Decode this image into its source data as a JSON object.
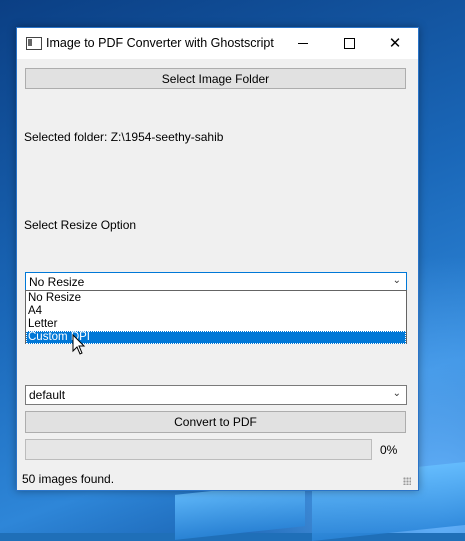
{
  "window": {
    "title": "Image to PDF Converter with Ghostscript",
    "controls": {
      "minimize": "minimize",
      "maximize": "maximize",
      "close": "✕"
    }
  },
  "select_folder_button": "Select Image Folder",
  "selected_folder_text": "Selected folder: Z:\\1954-seethy-sahib",
  "resize_label": "Select Resize Option",
  "resize_combo": {
    "value": "No Resize",
    "options": [
      "No Resize",
      "A4",
      "Letter",
      "Custom DPI"
    ],
    "highlighted_option": "Custom DPI"
  },
  "quality_combo": {
    "value": "default"
  },
  "convert_button": "Convert to PDF",
  "progress": {
    "value": 0,
    "label": "0%"
  },
  "status_text": "50 images found.",
  "colors": {
    "accent": "#0078d7",
    "progress_fill": "#06b025",
    "window_bg": "#f0f0f0"
  },
  "icons": [
    "app-icon",
    "minimize-icon",
    "maximize-icon",
    "close-icon",
    "chevron-down-icon",
    "resize-grip-icon",
    "mouse-cursor-icon"
  ]
}
